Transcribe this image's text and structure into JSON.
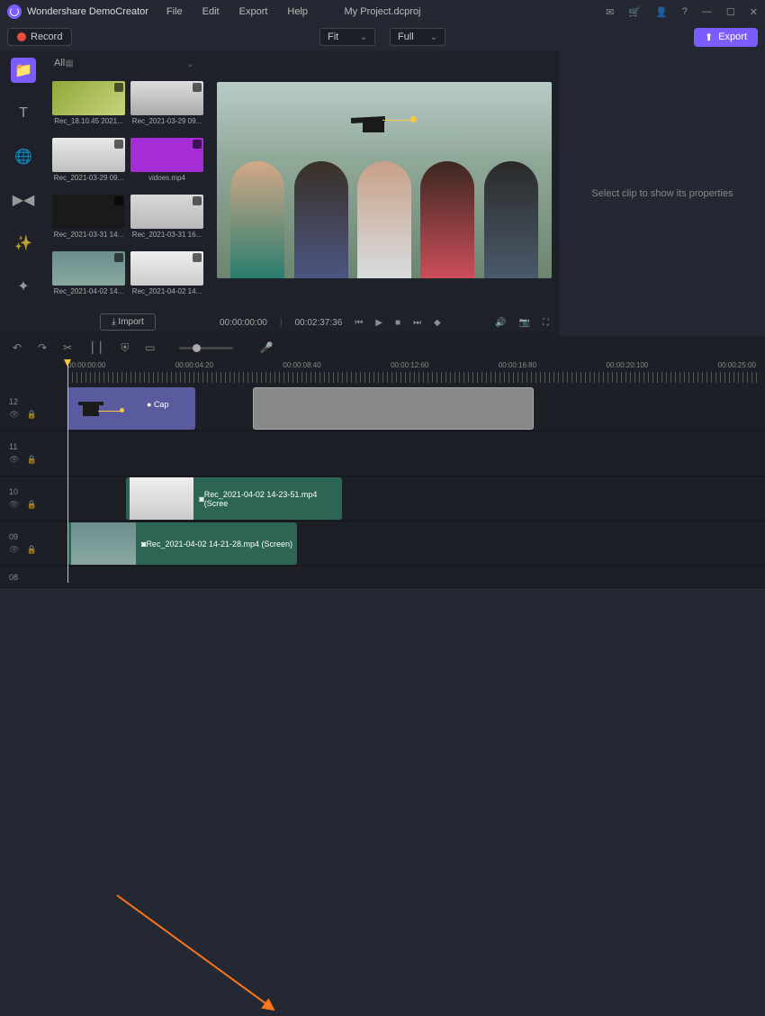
{
  "app_name": "Wondershare DemoCreator",
  "menu": [
    "File",
    "Edit",
    "Export",
    "Help"
  ],
  "doc_name": "My Project.dcproj",
  "record_label": "Record",
  "fit_sel": "Fit",
  "full_sel": "Full",
  "export_label": "Export",
  "media_filter": "All",
  "thumbs": [
    {
      "label": "Rec_18.10.45 2021..."
    },
    {
      "label": "Rec_2021-03-29 09..."
    },
    {
      "label": "Rec_2021-03-29 09..."
    },
    {
      "label": "vidoes.mp4"
    },
    {
      "label": "Rec_2021-03-31 14..."
    },
    {
      "label": "Rec_2021-03-31 16..."
    },
    {
      "label": "Rec_2021-04-02 14..."
    },
    {
      "label": "Rec_2021-04-02 14..."
    }
  ],
  "import_label": "Import",
  "props_empty": "Select clip to show its properties",
  "time_current": "00:00:00:00",
  "time_total": "00:02:37:36",
  "ruler": [
    "00:00:00:00",
    "00:00:04:20",
    "00:00:08:40",
    "00:00:12:60",
    "00:00:16:80",
    "00:00:20:100",
    "00:00:25:00"
  ],
  "track_labels": [
    "12",
    "11",
    "10",
    "09",
    "08"
  ],
  "cap_label": "Cap",
  "clip_v2": "Rec_2021-04-02 14-23-51.mp4 (Scree",
  "clip_v3": "Rec_2021-04-02 14-21-28.mp4 (Screen)"
}
